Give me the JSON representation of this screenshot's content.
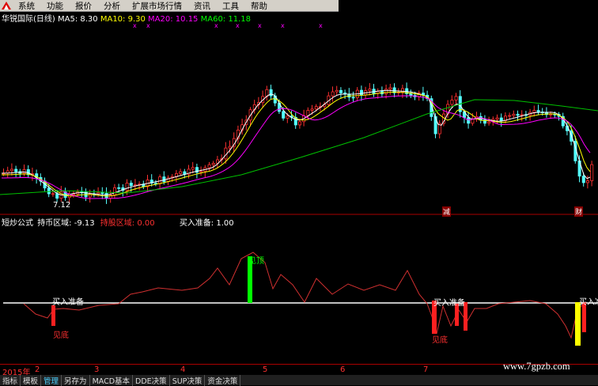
{
  "menu": [
    "系统",
    "功能",
    "报价",
    "分析",
    "扩展市场行情",
    "资讯",
    "工具",
    "帮助"
  ],
  "price_header": {
    "name": "华锐国际(日线)",
    "ma": [
      {
        "label": "MA5: 8.30",
        "color": "#ffffff"
      },
      {
        "label": "MA10: 9.30",
        "color": "#ffff00"
      },
      {
        "label": "MA20: 10.15",
        "color": "#ff00ff"
      },
      {
        "label": "MA60: 11.18",
        "color": "#00ff00"
      }
    ]
  },
  "price_low_label": "7.12",
  "price_markers": [
    "减",
    "财"
  ],
  "indicator_header": {
    "title": "短炒公式",
    "value1": "持币区域: -9.13",
    "value2": "持股区域: 0.00",
    "value3": "买入准备: 1.00"
  },
  "indicator_labels": {
    "buy_prepare": "买入准备",
    "bottom": "见底",
    "top": "见顶",
    "right_cut": "买入准"
  },
  "timeline": {
    "year": "2015年",
    "months": [
      "2",
      "3",
      "4",
      "5",
      "6",
      "7"
    ]
  },
  "tabs": [
    "指标",
    "模板",
    "管理",
    "另存为",
    "MACD基本",
    "DDE决策",
    "SUP决策",
    "资金决策"
  ],
  "active_tab": "管理",
  "watermark": "www.7gpzb.com",
  "colors": {
    "up": "#ff3030",
    "down": "#54ffff",
    "ma5": "#ffffff",
    "ma10": "#ffff00",
    "ma20": "#ff00ff",
    "ma60": "#00c000"
  }
}
